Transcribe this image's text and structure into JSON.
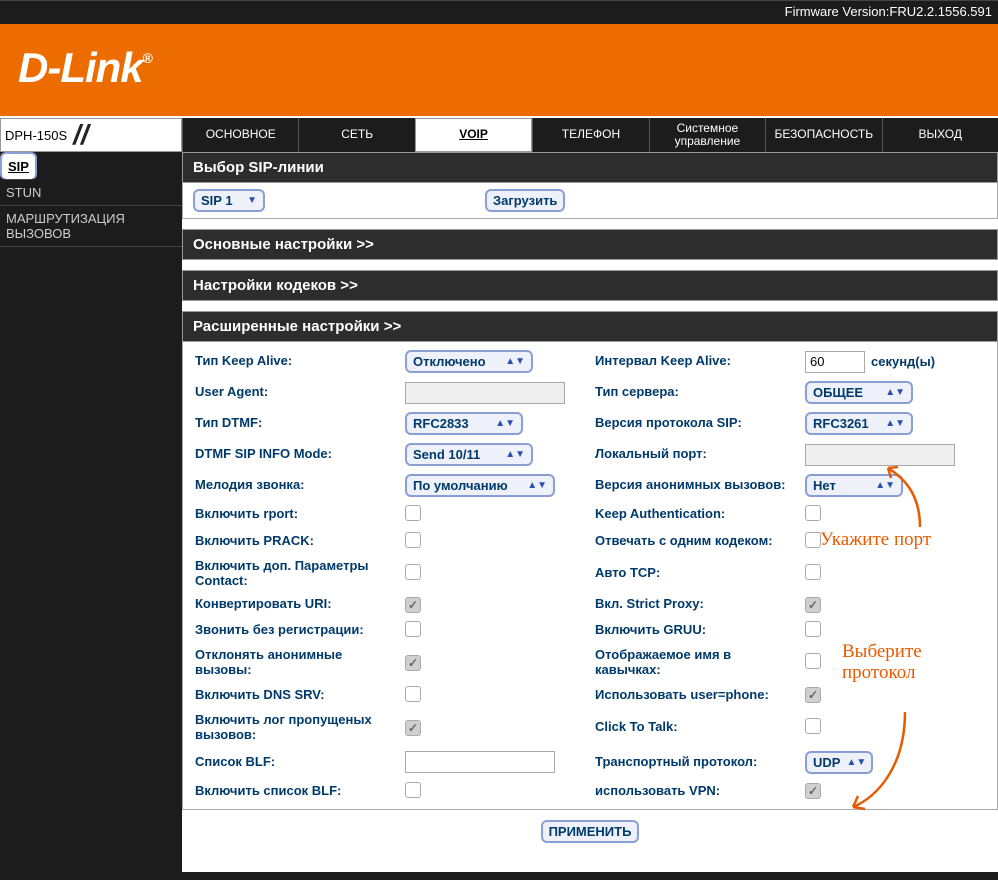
{
  "firmware_label": "Firmware Version:FRU2.2.1556.591",
  "brand": "D-Link",
  "device_model": "DPH-150S",
  "main_tabs": [
    "ОСНОВНОЕ",
    "СЕТЬ",
    "VOIP",
    "ТЕЛЕФОН",
    "Системное управление",
    "БЕЗОПАСНОСТЬ",
    "ВЫХОД"
  ],
  "active_tab_index": 2,
  "side_items": [
    "SIP",
    "STUN",
    "МАРШРУТИЗАЦИЯ ВЫЗОВОВ"
  ],
  "side_active_index": 0,
  "sections": {
    "sip_line": "Выбор SIP-линии",
    "basic": "Основные настройки >>",
    "codec": "Настройки кодеков >>",
    "advanced": "Расширенные настройки >>"
  },
  "sip_selector": "SIP 1",
  "load_btn": "Загрузить",
  "apply_btn": "ПРИМЕНИТЬ",
  "fields": {
    "keep_alive_type": {
      "label": "Тип Keep Alive:",
      "value": "Отключено"
    },
    "keep_alive_interval": {
      "label": "Интервал Keep Alive:",
      "value": "60",
      "unit": "секунд(ы)"
    },
    "user_agent": {
      "label": "User Agent:",
      "value": ""
    },
    "server_type": {
      "label": "Тип сервера:",
      "value": "ОБЩЕЕ"
    },
    "dtmf_type": {
      "label": "Тип DTMF:",
      "value": "RFC2833"
    },
    "sip_version": {
      "label": "Версия протокола SIP:",
      "value": "RFC3261"
    },
    "dtmf_info": {
      "label": "DTMF SIP INFO Mode:",
      "value": "Send 10/11"
    },
    "local_port": {
      "label": "Локальный порт:",
      "value": ""
    },
    "ringtone": {
      "label": "Мелодия звонка:",
      "value": "По умолчанию"
    },
    "anon_ver": {
      "label": "Версия анонимных вызовов:",
      "value": "Нет"
    },
    "rport": {
      "label": "Включить rport:",
      "checked": false
    },
    "keep_auth": {
      "label": "Keep Authentication:",
      "checked": false
    },
    "prack": {
      "label": "Включить PRACK:",
      "checked": false
    },
    "one_codec": {
      "label": "Отвечать с одним кодеком:",
      "checked": false
    },
    "extra_contact": {
      "label": "Включить доп. Параметры Contact:",
      "checked": false
    },
    "auto_tcp": {
      "label": "Авто TCP:",
      "checked": false
    },
    "convert_uri": {
      "label": "Конвертировать URI:",
      "checked": true
    },
    "strict_proxy": {
      "label": "Вкл. Strict Proxy:",
      "checked": true
    },
    "call_unreg": {
      "label": "Звонить без регистрации:",
      "checked": false
    },
    "gruu": {
      "label": "Включить GRUU:",
      "checked": false
    },
    "reject_anon": {
      "label": "Отклонять анонимные вызовы:",
      "checked": true
    },
    "name_quotes": {
      "label": "Отображаемое имя в кавычках:",
      "checked": false
    },
    "dns_srv": {
      "label": "Включить DNS SRV:",
      "checked": false
    },
    "user_phone": {
      "label": "Использовать user=phone:",
      "checked": true
    },
    "missed_log": {
      "label": "Включить лог пропущеных вызовов:",
      "checked": true
    },
    "click_talk": {
      "label": "Click To Talk:",
      "checked": false
    },
    "blf_list": {
      "label": "Список BLF:",
      "value": ""
    },
    "transport": {
      "label": "Транспортный протокол:",
      "value": "UDP"
    },
    "enable_blf": {
      "label": "Включить список BLF:",
      "checked": false
    },
    "use_vpn": {
      "label": "использовать VPN:",
      "checked": true
    }
  },
  "annotations": {
    "port": "Укажите порт",
    "protocol": "Выберите протокол"
  }
}
